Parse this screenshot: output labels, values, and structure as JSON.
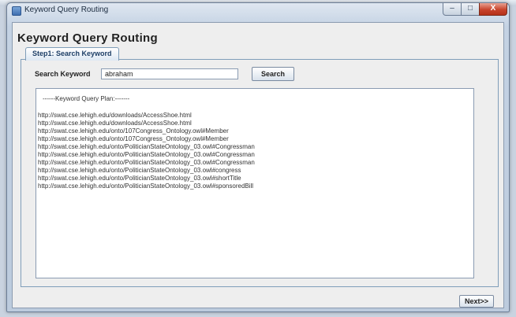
{
  "window": {
    "title": "Keyword Query Routing",
    "controls": {
      "minimize": "–",
      "maximize": "□",
      "close": "X"
    }
  },
  "page": {
    "heading": "Keyword Query Routing",
    "tab_label": "Step1: Search Keyword"
  },
  "search": {
    "label": "Search Keyword",
    "value": "abraham",
    "button": "Search"
  },
  "plan": {
    "header": "------Keyword Query Plan:-------",
    "lines": [
      "http://swat.cse.lehigh.edu/downloads/AccessShoe.html",
      "http://swat.cse.lehigh.edu/downloads/AccessShoe.html",
      "http://swat.cse.lehigh.edu/onto/107Congress_Ontology.owl#Member",
      "http://swat.cse.lehigh.edu/onto/107Congress_Ontology.owl#Member",
      "http://swat.cse.lehigh.edu/onto/PoliticianStateOntology_03.owl#Congressman",
      "http://swat.cse.lehigh.edu/onto/PoliticianStateOntology_03.owl#Congressman",
      "http://swat.cse.lehigh.edu/onto/PoliticianStateOntology_03.owl#Congressman",
      "http://swat.cse.lehigh.edu/onto/PoliticianStateOntology_03.owl#congress",
      "http://swat.cse.lehigh.edu/onto/PoliticianStateOntology_03.owl#shortTitle",
      "http://swat.cse.lehigh.edu/onto/PoliticianStateOntology_03.owl#sponsoredBill"
    ]
  },
  "footer": {
    "next_button": "Next>>"
  }
}
